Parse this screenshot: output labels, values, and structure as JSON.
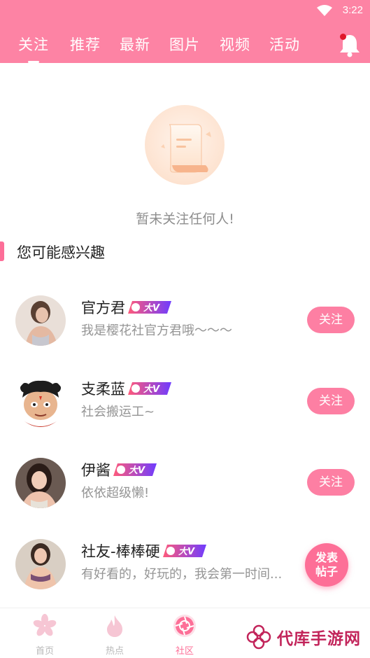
{
  "status_bar": {
    "time": "3:22"
  },
  "tabs": [
    {
      "label": "关注",
      "active": true
    },
    {
      "label": "推荐"
    },
    {
      "label": "最新"
    },
    {
      "label": "图片"
    },
    {
      "label": "视频"
    },
    {
      "label": "活动"
    }
  ],
  "empty_state": {
    "message": "暂未关注任何人!"
  },
  "section": {
    "title": "您可能感兴趣"
  },
  "badge_text": "大V",
  "users": [
    {
      "name": "官方君",
      "desc": "我是樱花社官方君哦～～～",
      "button": "关注"
    },
    {
      "name": "支柔蓝",
      "desc": "社会搬运工~",
      "button": "关注"
    },
    {
      "name": "伊酱",
      "desc": "依依超级懒!",
      "button": "关注"
    },
    {
      "name": "社友-棒棒硬",
      "desc": "有好看的，好玩的，我会第一时间...",
      "button": ""
    }
  ],
  "fab": {
    "line1": "发表",
    "line2": "帖子"
  },
  "bottom_nav": [
    {
      "label": "首页"
    },
    {
      "label": "热点"
    },
    {
      "label": "社区",
      "active": true
    }
  ],
  "watermark": {
    "text": "代库手游网"
  },
  "colors": {
    "primary": "#fd83a4",
    "accent": "#fd6f97"
  }
}
